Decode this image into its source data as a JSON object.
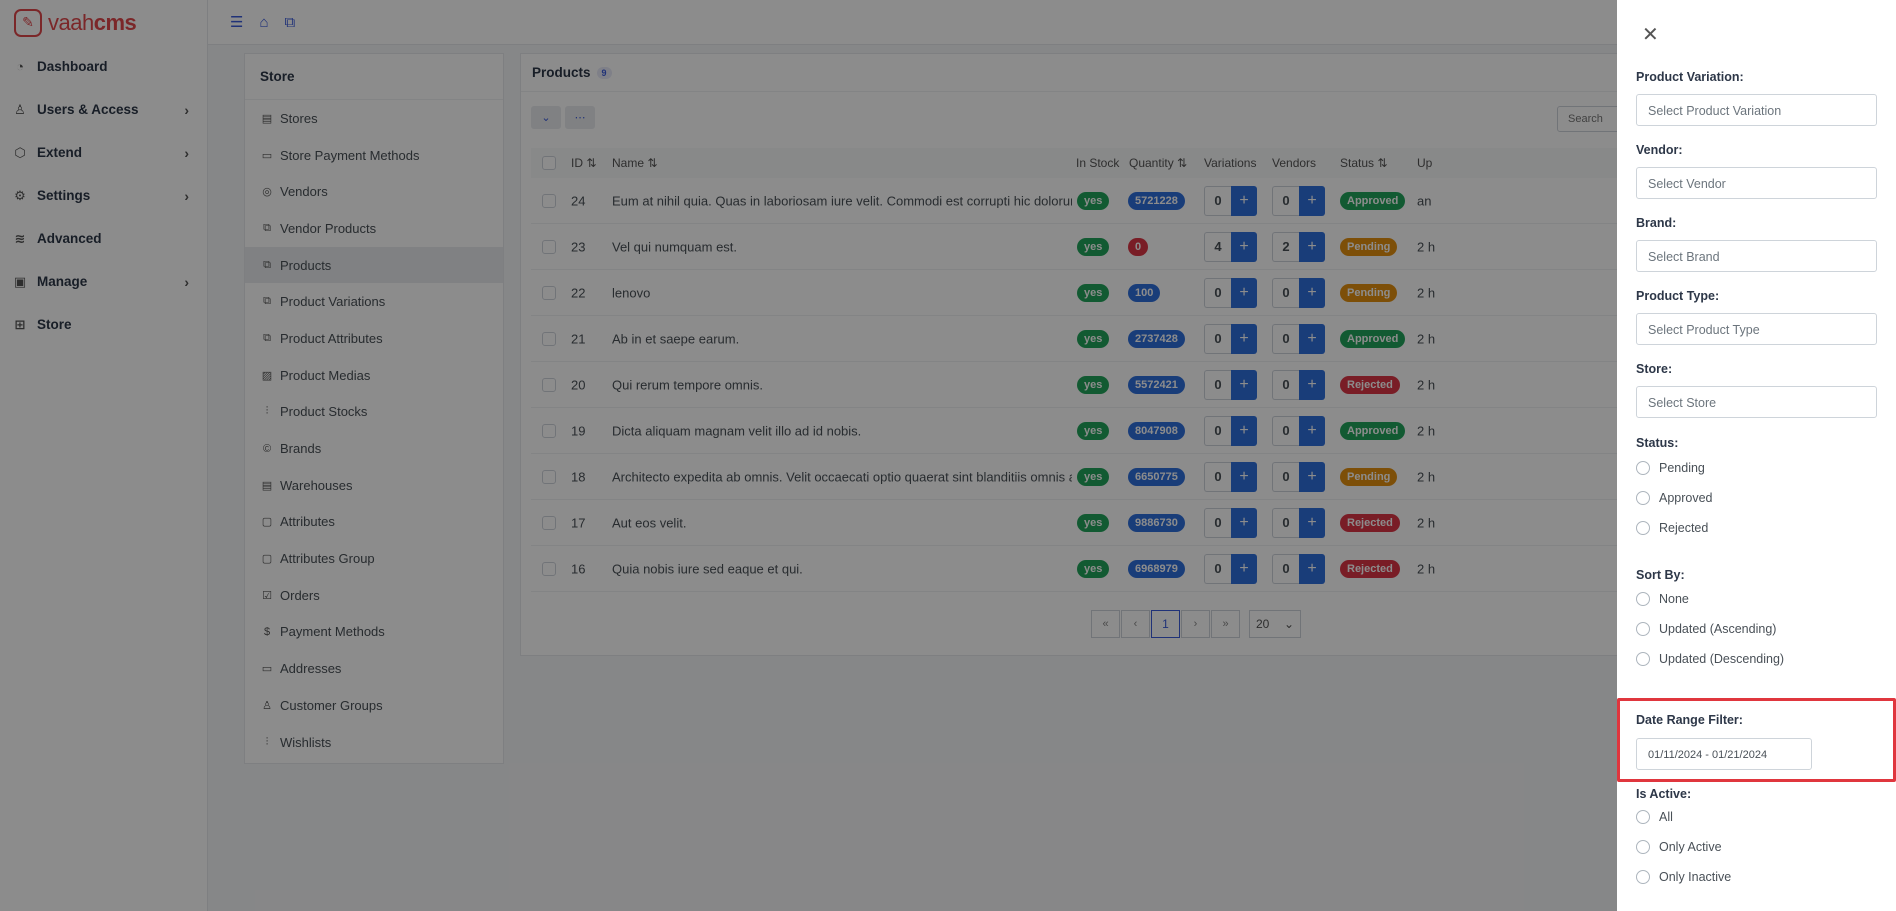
{
  "app": {
    "logo_text_light": "vaah",
    "logo_text_bold": "cms"
  },
  "leftnav": [
    {
      "label": "Dashboard",
      "icon": "dashboard-icon",
      "expandable": false
    },
    {
      "label": "Users & Access",
      "icon": "user-icon",
      "expandable": true
    },
    {
      "label": "Extend",
      "icon": "box-icon",
      "expandable": true
    },
    {
      "label": "Settings",
      "icon": "gear-icon",
      "expandable": true
    },
    {
      "label": "Advanced",
      "icon": "database-icon",
      "expandable": false
    },
    {
      "label": "Manage",
      "icon": "image-icon",
      "expandable": true
    },
    {
      "label": "Store",
      "icon": "grid-icon",
      "expandable": false
    }
  ],
  "subnav": {
    "title": "Store",
    "items": [
      "Stores",
      "Store Payment Methods",
      "Vendors",
      "Vendor Products",
      "Products",
      "Product Variations",
      "Product Attributes",
      "Product Medias",
      "Product Stocks",
      "Brands",
      "Warehouses",
      "Attributes",
      "Attributes Group",
      "Orders",
      "Payment Methods",
      "Addresses",
      "Customer Groups",
      "Wishlists"
    ],
    "active": "Products"
  },
  "products": {
    "title": "Products",
    "count": "9",
    "search_placeholder": "Search",
    "columns": {
      "id": "ID",
      "name": "Name",
      "in_stock": "In Stock",
      "quantity": "Quantity",
      "variations": "Variations",
      "vendors": "Vendors",
      "status": "Status",
      "updated": "Up"
    },
    "rows": [
      {
        "id": "24",
        "name": "Eum at nihil quia. Quas in laboriosam iure velit. Commodi est corrupti hic dolorum assumenda.",
        "in_stock": "yes",
        "quantity": "5721228",
        "qty_color": "blue",
        "variations": "0",
        "vendors": "0",
        "status": "Approved",
        "status_color": "green",
        "updated": "an"
      },
      {
        "id": "23",
        "name": "Vel qui numquam est.",
        "in_stock": "yes",
        "quantity": "0",
        "qty_color": "red",
        "variations": "4",
        "vendors": "2",
        "status": "Pending",
        "status_color": "orange",
        "updated": "2 h"
      },
      {
        "id": "22",
        "name": "lenovo",
        "in_stock": "yes",
        "quantity": "100",
        "qty_color": "blue",
        "variations": "0",
        "vendors": "0",
        "status": "Pending",
        "status_color": "orange",
        "updated": "2 h"
      },
      {
        "id": "21",
        "name": "Ab in et saepe earum.",
        "in_stock": "yes",
        "quantity": "2737428",
        "qty_color": "blue",
        "variations": "0",
        "vendors": "0",
        "status": "Approved",
        "status_color": "green",
        "updated": "2 h"
      },
      {
        "id": "20",
        "name": "Qui rerum tempore omnis.",
        "in_stock": "yes",
        "quantity": "5572421",
        "qty_color": "blue",
        "variations": "0",
        "vendors": "0",
        "status": "Rejected",
        "status_color": "red",
        "updated": "2 h"
      },
      {
        "id": "19",
        "name": "Dicta aliquam magnam velit illo ad id nobis.",
        "in_stock": "yes",
        "quantity": "8047908",
        "qty_color": "blue",
        "variations": "0",
        "vendors": "0",
        "status": "Approved",
        "status_color": "green",
        "updated": "2 h"
      },
      {
        "id": "18",
        "name": "Architecto expedita ab omnis. Velit occaecati optio quaerat sint blanditiis omnis at.",
        "in_stock": "yes",
        "quantity": "6650775",
        "qty_color": "blue",
        "variations": "0",
        "vendors": "0",
        "status": "Pending",
        "status_color": "orange",
        "updated": "2 h"
      },
      {
        "id": "17",
        "name": "Aut eos velit.",
        "in_stock": "yes",
        "quantity": "9886730",
        "qty_color": "blue",
        "variations": "0",
        "vendors": "0",
        "status": "Rejected",
        "status_color": "red",
        "updated": "2 h"
      },
      {
        "id": "16",
        "name": "Quia nobis iure sed eaque et qui.",
        "in_stock": "yes",
        "quantity": "6968979",
        "qty_color": "blue",
        "variations": "0",
        "vendors": "0",
        "status": "Rejected",
        "status_color": "red",
        "updated": "2 h"
      }
    ],
    "pagination": {
      "current_page": "1",
      "page_size": "20"
    }
  },
  "filters": {
    "product_variation": {
      "label": "Product Variation:",
      "placeholder": "Select Product Variation"
    },
    "vendor": {
      "label": "Vendor:",
      "placeholder": "Select Vendor"
    },
    "brand": {
      "label": "Brand:",
      "placeholder": "Select Brand"
    },
    "product_type": {
      "label": "Product Type:",
      "placeholder": "Select Product Type"
    },
    "store": {
      "label": "Store:",
      "placeholder": "Select Store"
    },
    "status": {
      "label": "Status:",
      "options": [
        "Pending",
        "Approved",
        "Rejected"
      ]
    },
    "sort_by": {
      "label": "Sort By:",
      "options": [
        "None",
        "Updated (Ascending)",
        "Updated (Descending)"
      ]
    },
    "date_range": {
      "label": "Date Range Filter:",
      "value": "01/11/2024 - 01/21/2024"
    },
    "is_active": {
      "label": "Is Active:",
      "options": [
        "All",
        "Only Active",
        "Only Inactive"
      ]
    }
  },
  "colors": {
    "brand": "#e0474c",
    "accent": "#3b5bdb",
    "highlight": "#e0363e"
  }
}
